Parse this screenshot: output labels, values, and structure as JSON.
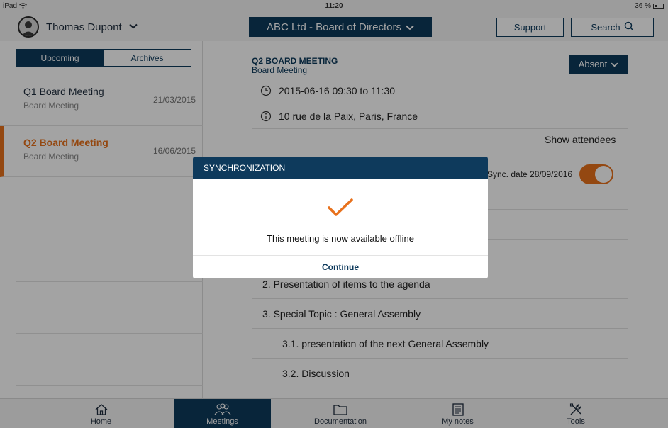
{
  "status_bar": {
    "device": "iPad",
    "time": "11:20",
    "battery": "36 %"
  },
  "header": {
    "user_name": "Thomas Dupont",
    "company_select": "ABC Ltd - Board of Directors",
    "support_label": "Support",
    "search_label": "Search"
  },
  "sidebar": {
    "tabs": [
      {
        "label": "Upcoming",
        "active": true
      },
      {
        "label": "Archives",
        "active": false
      }
    ],
    "meetings": [
      {
        "title": "Q1 Board Meeting",
        "type": "Board Meeting",
        "date": "21/03/2015",
        "selected": false
      },
      {
        "title": "Q2 Board Meeting",
        "type": "Board Meeting",
        "date": "16/06/2015",
        "selected": true
      }
    ]
  },
  "detail": {
    "title": "Q2 BOARD MEETING",
    "subtitle": "Board Meeting",
    "attendance_select": "Absent",
    "datetime": "2015-06-16 09:30 to 11:30",
    "location": "10 rue de la Paix, Paris, France",
    "show_attendees": "Show attendees",
    "sync_date": "Sync. date 28/09/2016",
    "sync_enabled": true,
    "agenda": [
      {
        "label": "2. Presentation of items to the agenda",
        "level": 1
      },
      {
        "label": "3. Special Topic : General Assembly",
        "level": 1
      },
      {
        "label": "3.1. presentation of the next General Assembly",
        "level": 2
      },
      {
        "label": "3.2. Discussion",
        "level": 2
      }
    ]
  },
  "modal": {
    "title": "SYNCHRONIZATION",
    "message": "This meeting is now available offline",
    "button": "Continue",
    "icon": "checkmark-icon"
  },
  "tab_bar": {
    "items": [
      {
        "label": "Home",
        "icon": "home-icon",
        "active": false
      },
      {
        "label": "Meetings",
        "icon": "people-icon",
        "active": true
      },
      {
        "label": "Documentation",
        "icon": "folder-icon",
        "active": false
      },
      {
        "label": "My notes",
        "icon": "notes-icon",
        "active": false
      },
      {
        "label": "Tools",
        "icon": "tools-icon",
        "active": false
      }
    ]
  },
  "colors": {
    "navy": "#0e3a5c",
    "accent": "#e8711c"
  }
}
